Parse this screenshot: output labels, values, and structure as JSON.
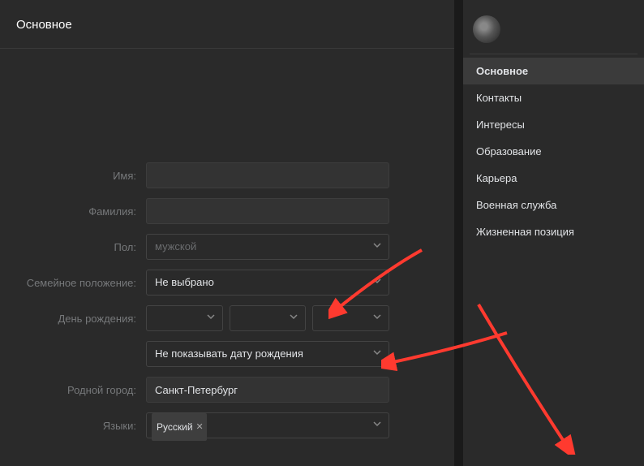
{
  "header": {
    "title": "Основное"
  },
  "form": {
    "name_label": "Имя:",
    "name_value": "",
    "surname_label": "Фамилия:",
    "surname_value": "",
    "gender_label": "Пол:",
    "gender_value": "мужской",
    "marital_label": "Семейное положение:",
    "marital_value": "Не выбрано",
    "birthday_label": "День рождения:",
    "birthday_day": "",
    "birthday_month": "",
    "birthday_year": "",
    "birthday_visibility": "Не показывать дату рождения",
    "hometown_label": "Родной город:",
    "hometown_value": "Санкт-Петербург",
    "languages_label": "Языки:",
    "language_tag": "Русский"
  },
  "sidebar": {
    "items": [
      {
        "label": "Основное",
        "active": true
      },
      {
        "label": "Контакты",
        "active": false
      },
      {
        "label": "Интересы",
        "active": false
      },
      {
        "label": "Образование",
        "active": false
      },
      {
        "label": "Карьера",
        "active": false
      },
      {
        "label": "Военная служба",
        "active": false
      },
      {
        "label": "Жизненная позиция",
        "active": false
      }
    ]
  },
  "colors": {
    "arrow": "#ff3a2f"
  }
}
